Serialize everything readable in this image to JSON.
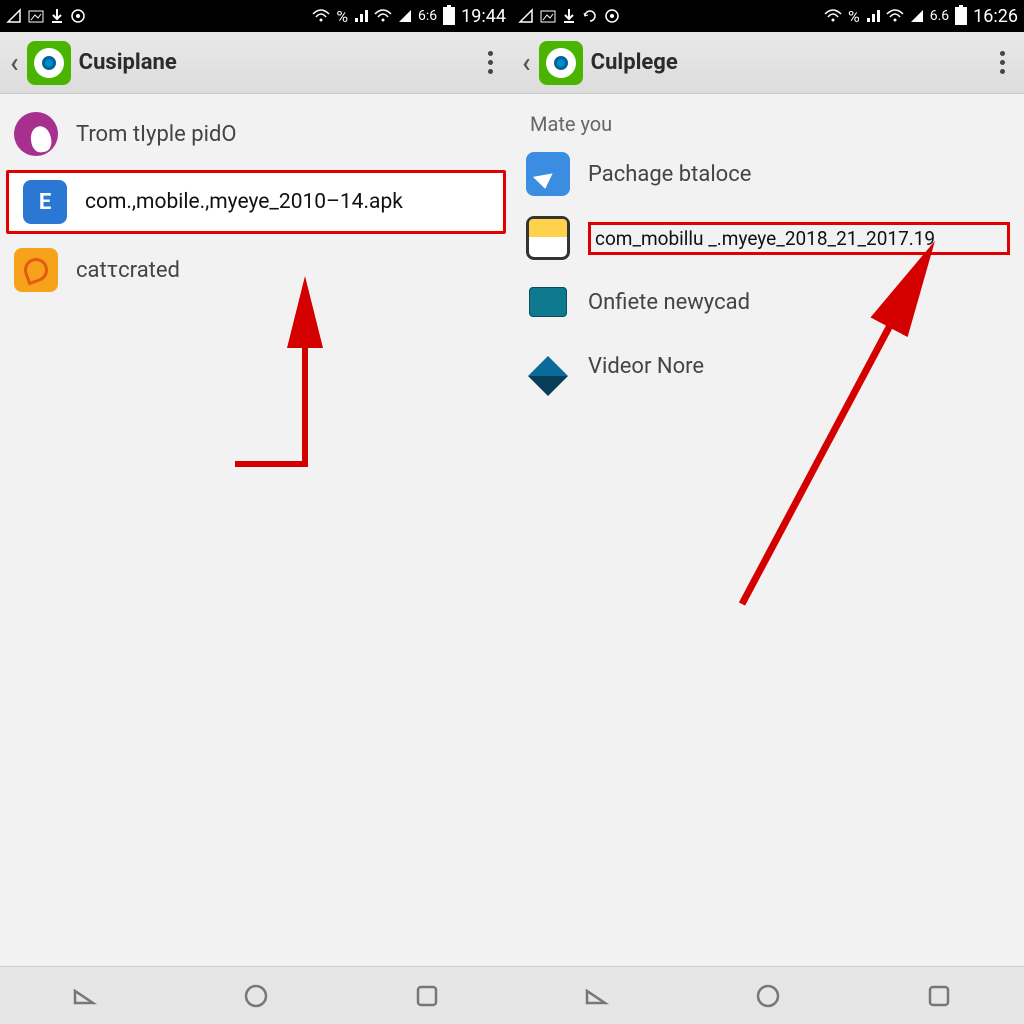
{
  "left": {
    "status": {
      "time": "19:44",
      "pct": "6:6"
    },
    "title": "Cusiplane",
    "rows": [
      {
        "label": "Trom tIyple pidO"
      },
      {
        "label": "com.,mobile.,myeye_2010–14.apk"
      },
      {
        "label": "catτcrated"
      }
    ]
  },
  "right": {
    "status": {
      "time": "16:26",
      "pct": "6.6"
    },
    "title": "Culplege",
    "section": "Mate you",
    "rows": [
      {
        "label": "Pachage btaloce"
      },
      {
        "label": "com_mobillu _.myeye_2018_21_2017.19"
      },
      {
        "label": "Onfiete newycad"
      },
      {
        "label": "Videor Nore"
      }
    ]
  },
  "glyph": {
    "percent": "%",
    "wifi": "📶"
  }
}
